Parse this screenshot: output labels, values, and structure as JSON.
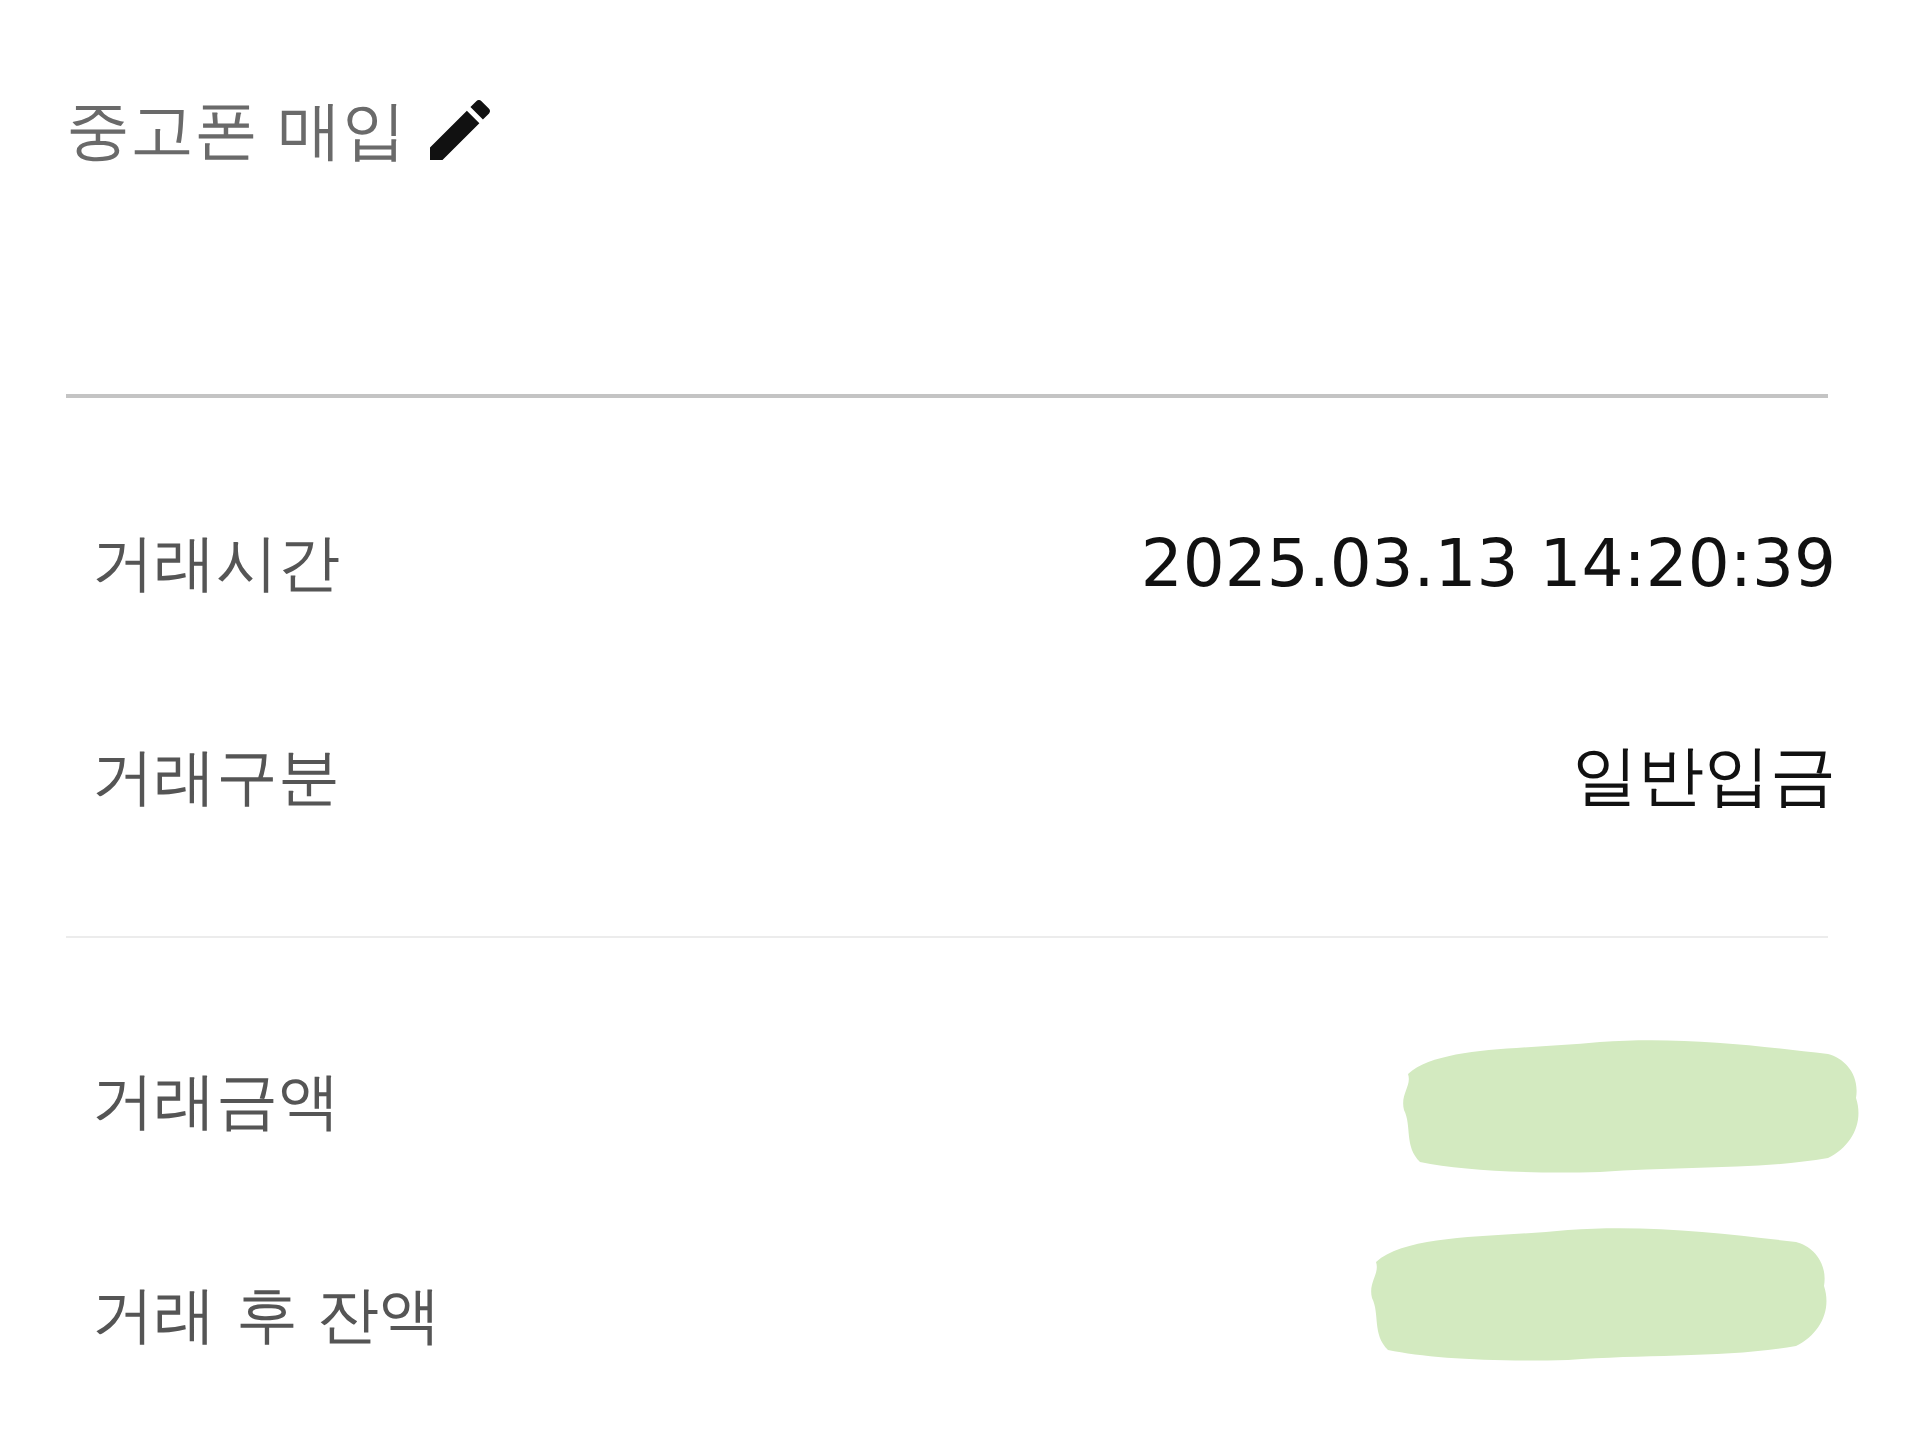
{
  "header": {
    "title": "중고폰 매입"
  },
  "sections": [
    {
      "rows": [
        {
          "label": "거래시간",
          "value": "2025.03.13 14:20:39",
          "redacted": false
        },
        {
          "label": "거래구분",
          "value": "일반입금",
          "redacted": false
        }
      ]
    },
    {
      "rows": [
        {
          "label": "거래금액",
          "redacted": true
        },
        {
          "label": "거래 후 잔액",
          "redacted": true
        }
      ]
    }
  ]
}
